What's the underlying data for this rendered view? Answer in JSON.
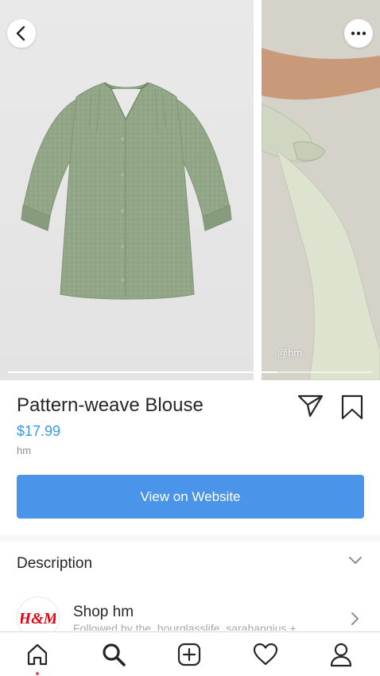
{
  "gallery": {
    "watermark": "@hm",
    "progress": 0.74
  },
  "product": {
    "title": "Pattern-weave Blouse",
    "price": "$17.99",
    "merchant": "hm"
  },
  "actions": {
    "view_label": "View on Website"
  },
  "description": {
    "label": "Description"
  },
  "shop": {
    "name": "Shop hm",
    "followed_by": "Followed by the_hourglasslife, sarahangius +",
    "logo_text": "H&M"
  },
  "tabs": [
    "home-icon",
    "search-icon",
    "new-post-icon",
    "activity-icon",
    "profile-icon"
  ],
  "colors": {
    "accent": "#3897f0",
    "button": "#4a95ea",
    "blouse": "#8fa484",
    "brand_red": "#e50010"
  }
}
